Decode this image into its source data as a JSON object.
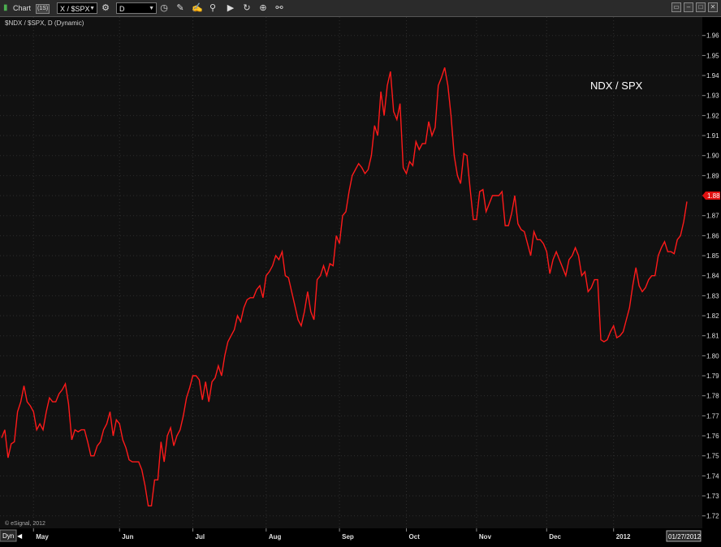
{
  "toolbar": {
    "chart_label": "Chart",
    "chart_badge": "(1S)",
    "symbol_value": "X / $SPX",
    "interval_value": "D"
  },
  "chart_header": "$NDX / $SPX, D (Dynamic)",
  "watermark": "© eSignal, 2012",
  "mode_label": "Dyn",
  "date_badge": "01/27/2012",
  "last_price_label": "1.88",
  "colors": {
    "line": "#ff1a1a",
    "background": "#111111",
    "axis": "#000000"
  },
  "chart_data": {
    "type": "line",
    "title": "NDX / SPX",
    "ylim": [
      1.715,
      1.968
    ],
    "y_ticks": [
      1.72,
      1.73,
      1.74,
      1.75,
      1.76,
      1.77,
      1.78,
      1.79,
      1.8,
      1.81,
      1.82,
      1.83,
      1.84,
      1.85,
      1.86,
      1.87,
      1.88,
      1.89,
      1.9,
      1.91,
      1.92,
      1.93,
      1.94,
      1.95,
      1.96
    ],
    "y_tick_labels": [
      "1.72",
      "1.73",
      "1.74",
      "1.75",
      "1.76",
      "1.77",
      "1.78",
      "1.79",
      "1.80",
      "1.81",
      "1.82",
      "1.83",
      "1.84",
      "1.85",
      "1.86",
      "1.87",
      "1.88",
      "1.89",
      "1.90",
      "1.91",
      "1.92",
      "1.93",
      "1.94",
      "1.95",
      "1.96"
    ],
    "x_labels": [
      "May",
      "Jun",
      "Jul",
      "Aug",
      "Sep",
      "Oct",
      "Nov",
      "Dec",
      "2012"
    ],
    "x_label_index": [
      10,
      37,
      60,
      83,
      106,
      127,
      149,
      171,
      192
    ],
    "grid": true,
    "series": [
      {
        "values": [
          1.759,
          1.763,
          1.749,
          1.756,
          1.757,
          1.772,
          1.777,
          1.785,
          1.777,
          1.775,
          1.772,
          1.763,
          1.766,
          1.763,
          1.772,
          1.779,
          1.777,
          1.777,
          1.781,
          1.783,
          1.786,
          1.776,
          1.758,
          1.763,
          1.762,
          1.763,
          1.763,
          1.757,
          1.75,
          1.75,
          1.755,
          1.757,
          1.763,
          1.766,
          1.772,
          1.76,
          1.768,
          1.766,
          1.758,
          1.754,
          1.748,
          1.747,
          1.747,
          1.747,
          1.743,
          1.735,
          1.725,
          1.725,
          1.738,
          1.738,
          1.757,
          1.747,
          1.76,
          1.764,
          1.755,
          1.76,
          1.763,
          1.77,
          1.779,
          1.784,
          1.79,
          1.79,
          1.788,
          1.778,
          1.787,
          1.777,
          1.787,
          1.789,
          1.795,
          1.79,
          1.8,
          1.807,
          1.81,
          1.813,
          1.82,
          1.817,
          1.824,
          1.828,
          1.829,
          1.829,
          1.833,
          1.835,
          1.829,
          1.84,
          1.842,
          1.845,
          1.85,
          1.848,
          1.852,
          1.84,
          1.839,
          1.832,
          1.825,
          1.818,
          1.815,
          1.822,
          1.832,
          1.822,
          1.818,
          1.838,
          1.84,
          1.845,
          1.84,
          1.846,
          1.845,
          1.86,
          1.856,
          1.87,
          1.872,
          1.882,
          1.89,
          1.893,
          1.896,
          1.894,
          1.891,
          1.893,
          1.9,
          1.915,
          1.91,
          1.932,
          1.92,
          1.935,
          1.942,
          1.922,
          1.918,
          1.926,
          1.894,
          1.891,
          1.897,
          1.895,
          1.907,
          1.903,
          1.906,
          1.906,
          1.917,
          1.91,
          1.914,
          1.935,
          1.939,
          1.944,
          1.935,
          1.92,
          1.9,
          1.89,
          1.886,
          1.901,
          1.9,
          1.883,
          1.868,
          1.868,
          1.882,
          1.883,
          1.872,
          1.876,
          1.88,
          1.88,
          1.88,
          1.882,
          1.865,
          1.865,
          1.871,
          1.88,
          1.866,
          1.863,
          1.862,
          1.856,
          1.85,
          1.862,
          1.858,
          1.858,
          1.856,
          1.852,
          1.841,
          1.848,
          1.852,
          1.848,
          1.844,
          1.84,
          1.848,
          1.85,
          1.854,
          1.85,
          1.84,
          1.842,
          1.832,
          1.834,
          1.838,
          1.838,
          1.808,
          1.807,
          1.808,
          1.812,
          1.815,
          1.809,
          1.81,
          1.812,
          1.818,
          1.824,
          1.835,
          1.844,
          1.835,
          1.832,
          1.834,
          1.838,
          1.84,
          1.84,
          1.85,
          1.854,
          1.857,
          1.852,
          1.852,
          1.851,
          1.858,
          1.86,
          1.867,
          1.877
        ]
      }
    ]
  }
}
